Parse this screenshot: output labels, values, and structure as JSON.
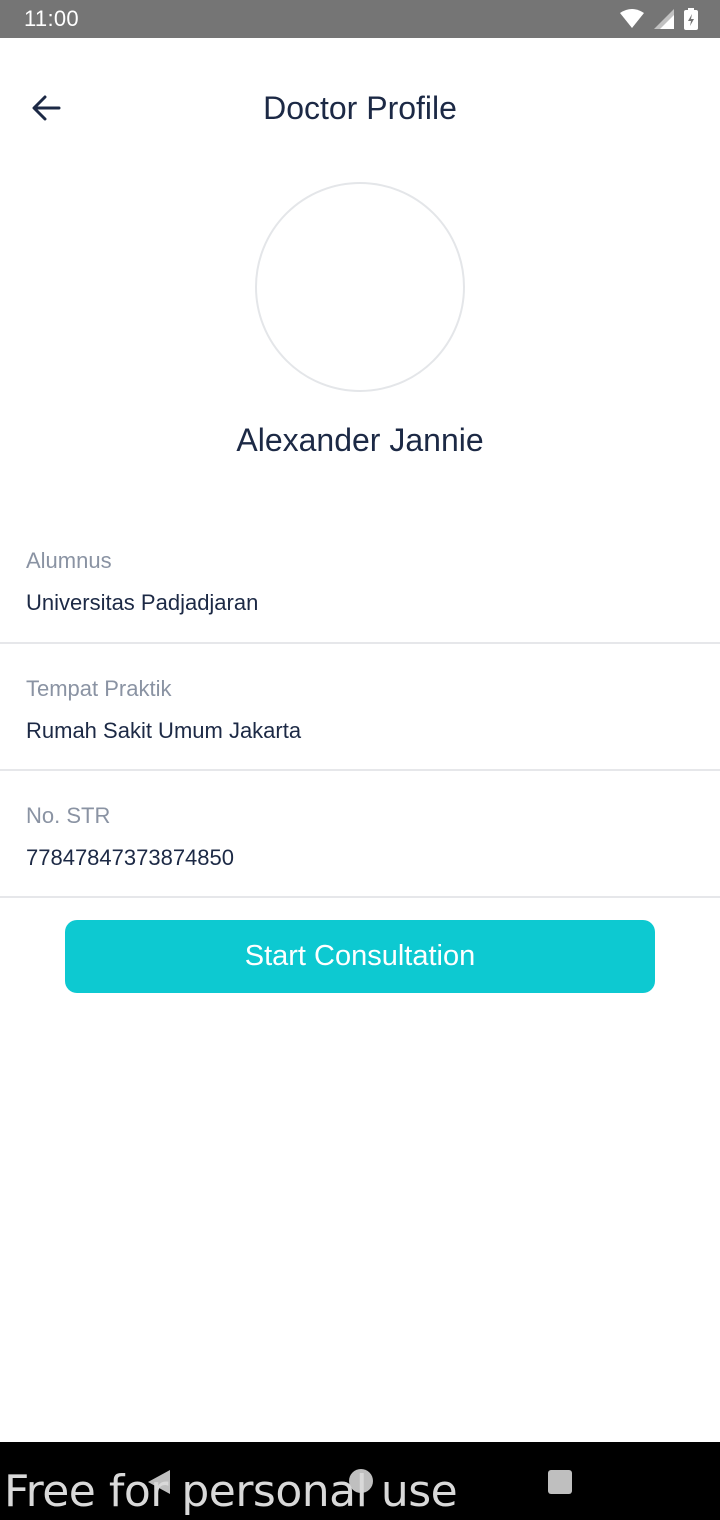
{
  "status_bar": {
    "time": "11:00",
    "icons": [
      "wifi-icon",
      "signal-icon",
      "battery-icon"
    ]
  },
  "header": {
    "title": "Doctor Profile",
    "back_icon": "arrow-left-icon"
  },
  "doctor": {
    "name": "Alexander Jannie"
  },
  "details": [
    {
      "label": "Alumnus",
      "value": "Universitas Padjadjaran"
    },
    {
      "label": "Tempat Praktik",
      "value": "Rumah Sakit Umum Jakarta"
    },
    {
      "label": "No. STR",
      "value": "77847847373874850"
    }
  ],
  "actions": {
    "start_label": "Start Consultation"
  },
  "nav_bar": {
    "icons": [
      "nav-back-icon",
      "nav-home-icon",
      "nav-recents-icon"
    ]
  },
  "watermark": "Free for personal use",
  "colors": {
    "accent": "#0dc9d1",
    "title": "#1c2945",
    "label": "#8a93a3",
    "status_bar": "#757575"
  }
}
